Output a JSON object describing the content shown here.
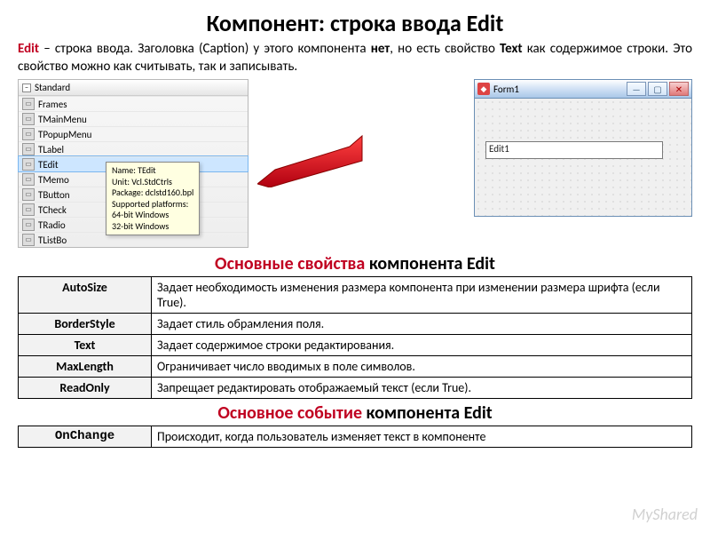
{
  "title": "Компонент: строка ввода Edit",
  "intro": {
    "lead": "Edit",
    "body1": " – строка ввода. Заголовка (Caption) у этого компонента ",
    "no": "нет",
    "body2": ", но есть свойство ",
    "textProp": "Text",
    "body3": " как содержимое строки. Это свойство можно как считывать, так и записывать."
  },
  "palette": {
    "header": "Standard",
    "items": [
      "Frames",
      "TMainMenu",
      "TPopupMenu",
      "TLabel",
      "TEdit",
      "TMemo",
      "TButton",
      "TCheck",
      "TRadio",
      "TListBo"
    ],
    "selectedIndex": 4
  },
  "tooltip": {
    "l1": "Name: TEdit",
    "l2": "Unit: Vcl.StdCtrls",
    "l3": "Package: dclstd160.bpl",
    "l4": "Supported platforms:",
    "l5": "    64-bit Windows",
    "l6": "    32-bit Windows"
  },
  "formwin": {
    "title": "Form1",
    "editText": "Edit1"
  },
  "section1": {
    "red": "Основные свойства",
    "rest": " компонента  Edit"
  },
  "propsTable": [
    {
      "k": "AutoSize",
      "v": "Задает необходимость изменения размера компонента при изменении размера шрифта (если True)."
    },
    {
      "k": "BorderStyle",
      "v": "Задает стиль обрамления поля."
    },
    {
      "k": "Text",
      "v": "Задает содержимое строки редактирования."
    },
    {
      "k": "MaxLength",
      "v": "Ограничивает число вводимых в поле символов."
    },
    {
      "k": "ReadOnly",
      "v": "Запрещает редактировать отображаемый текст (если True)."
    }
  ],
  "section2": {
    "red": "Основное событие",
    "rest": " компонента  Edit"
  },
  "eventTable": [
    {
      "k": "OnChange",
      "v": "Происходит, когда пользователь изменяет текст в компоненте"
    }
  ],
  "watermark": "MyShared"
}
